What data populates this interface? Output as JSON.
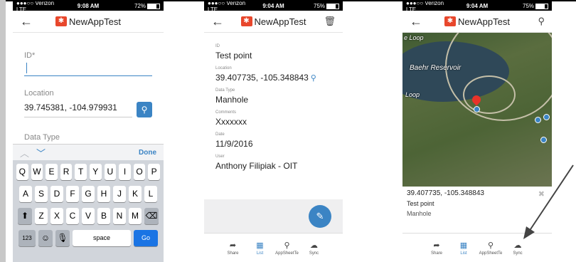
{
  "screen1": {
    "status": {
      "carrier": "●●●○○ Verizon  LTE",
      "time": "9:08 AM",
      "battery": "72%"
    },
    "nav": {
      "back": "←",
      "title": "NewAppTest"
    },
    "id_label": "ID*",
    "location_label": "Location",
    "location_value": "39.745381, -104.979931",
    "datatype_label": "Data Type",
    "toolbar": {
      "done": "Done"
    },
    "keyboard": {
      "row1": [
        "Q",
        "W",
        "E",
        "R",
        "T",
        "Y",
        "U",
        "I",
        "O",
        "P"
      ],
      "row2": [
        "A",
        "S",
        "D",
        "F",
        "G",
        "H",
        "J",
        "K",
        "L"
      ],
      "row3": [
        "Z",
        "X",
        "C",
        "V",
        "B",
        "N",
        "M"
      ],
      "num": "123",
      "space": "space",
      "go": "Go"
    }
  },
  "screen2": {
    "status": {
      "carrier": "●●●○○ Verizon  LTE",
      "time": "9:04 AM",
      "battery": "75%"
    },
    "nav": {
      "back": "←",
      "title": "NewAppTest"
    },
    "fields": [
      {
        "label": "ID",
        "value": "Test point"
      },
      {
        "label": "Location",
        "value": "39.407735, -105.348843"
      },
      {
        "label": "Data Type",
        "value": "Manhole"
      },
      {
        "label": "Comments",
        "value": "Xxxxxxx"
      },
      {
        "label": "Date",
        "value": "11/9/2016"
      },
      {
        "label": "User",
        "value": "Anthony Filipiak - OIT"
      }
    ]
  },
  "screen3": {
    "status": {
      "carrier": "●●●○○ Verizon  LTE",
      "time": "9:04 AM",
      "battery": "75%"
    },
    "nav": {
      "back": "←",
      "title": "NewAppTest"
    },
    "map_label": "Baehr Reservoir",
    "map_label2": "Loop",
    "map_label3": "e Loop",
    "info": {
      "location": "39.407735, -105.348843",
      "id": "Test point",
      "type": "Manhole"
    }
  },
  "bottom_nav": [
    {
      "label": "Share",
      "icon": "share-icon"
    },
    {
      "label": "List",
      "icon": "list-icon"
    },
    {
      "label": "AppSheetTe",
      "icon": "pin-icon"
    },
    {
      "label": "Sync",
      "icon": "cloud-icon"
    }
  ]
}
